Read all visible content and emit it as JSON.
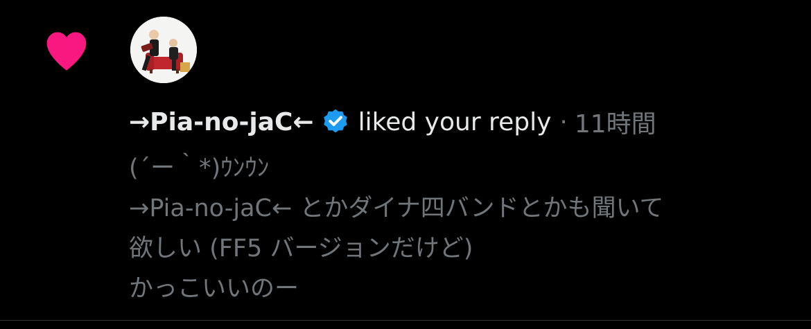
{
  "notification": {
    "user_name": "→Pia-no-jaC←",
    "action_text": "liked your reply",
    "separator": "·",
    "time_ago": "11時間",
    "reply_lines": [
      "(´ー｀*)ｳﾝｳﾝ",
      "→Pia-no-jaC← とかダイナ四バンドとかも聞いて",
      "欲しい (FF5 バージョンだけど)",
      "かっこいいのー"
    ]
  },
  "icons": {
    "like": "heart-icon",
    "verified": "verified-badge-icon",
    "avatar": "user-avatar"
  },
  "colors": {
    "background": "#000000",
    "like_pink": "#f91880",
    "verified_blue": "#1d9bf0",
    "primary_text": "#e7e9ea",
    "secondary_text": "#71767b",
    "divider": "#2f3336"
  }
}
